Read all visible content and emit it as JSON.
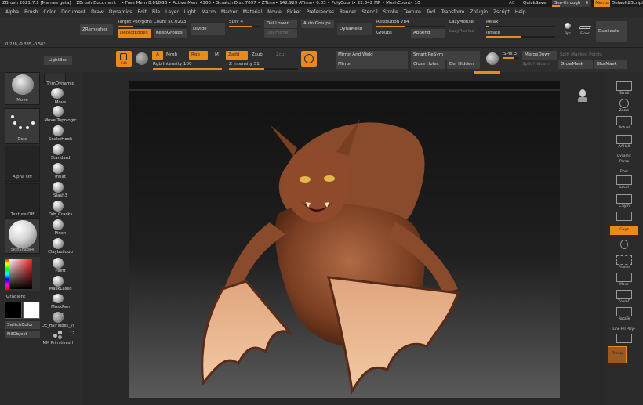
{
  "title_bar": {
    "app": "ZBrush 2021.7.1 [Marnes geta]",
    "document": "ZBrush Document",
    "stats": "• Free Mem 8.618GB • Active Mem 4360 • Scratch Disk 7097 • ZTime• 142.929 ATime• 0.03 • PolyCount• 22.342 MP • MeshCount• 10",
    "ac": "AC",
    "quicksave": "QuickSave",
    "see_through": "See-through",
    "see_through_value": "0",
    "menus_btn": "Menus",
    "default_zscript": "DefaultZScript"
  },
  "menu_bar": [
    "Alpha",
    "Brush",
    "Color",
    "Document",
    "Draw",
    "Dynamics",
    "Edit",
    "File",
    "Layer",
    "Light",
    "Macro",
    "Marker",
    "Material",
    "Movie",
    "Picker",
    "Preferences",
    "Render",
    "Stencil",
    "Stroke",
    "Texture",
    "Tool",
    "Transform",
    "Zplugin",
    "Zscript",
    "Help"
  ],
  "top_controls": {
    "zremesher": "ZRemesher",
    "target_poly": "Target Polygons Count 50.0203",
    "detect_edges": "DetectEdges",
    "keep_groups": "KeepGroups",
    "divide": "Divide",
    "sdiv": "SDiv 4",
    "del_lower": "Del Lower",
    "del_higher": "Del Higher",
    "auto_groups": "Auto Groups",
    "dynamesh": "DynaMesh",
    "resolution": "Resolution 784",
    "groups": "Groups",
    "append": "Append",
    "lazymouse": "LazyMouse",
    "lazyradius": "LazyRadius",
    "relax": "Relax",
    "inflate": "Inflate",
    "bpr": "Bpr",
    "floor": "Floor",
    "duplicate": "Duplicate"
  },
  "coords": "0.228,-0.385,-0.563",
  "tool_row": {
    "lightbox": "LightBox",
    "edit": "Edit",
    "a_label": "A",
    "mrgb": "Mrgb",
    "rgb": "Rgb",
    "m": "M",
    "zadd": "Zadd",
    "zsub": "Zsub",
    "zcut": "Zcut",
    "rgb_intensity": "Rgb Intensity 100",
    "z_intensity": "Z Intensity 51",
    "mirror_weld": "Mirror And Weld",
    "mirror": "Mirror",
    "smart_resym": "Smart ReSym",
    "close_holes": "Close Holes",
    "del_hidden": "Del Hidden",
    "spix": "SPix 3",
    "merge_down": "MergeDown",
    "split_hidden": "Split Hidden",
    "split_masked": "Split Masked Points",
    "grow_mask": "GrowMask",
    "blur_mask": "BlurMask"
  },
  "left_shelf": {
    "move": "Move",
    "dots": "Dots",
    "alpha_off": "Alpha Off",
    "texture_off": "Texture Off",
    "material": "SkinShade4",
    "gradient": "Gradient",
    "switch_color": "SwitchColor",
    "fill_object": "FillObject",
    "brushes": [
      "TrimDynamic",
      "Move",
      "Move Topologic",
      "SnakeHook",
      "Standard",
      "Inflat",
      "Slash3",
      "Orb_Cracks",
      "Pinch",
      "Claybuildup",
      "Paint",
      "MaskLasso",
      "MaskPen"
    ],
    "hairtubes": "DE_HairTubes_vi",
    "hairtubes_count": "6",
    "imm_primitives": "IMM PrimitivesH",
    "imm_count": "12"
  },
  "right_shelf": [
    "Scroll",
    "Zoom",
    "Actual",
    "AAHalf",
    "Persp",
    "Floor",
    "Local",
    "L.Sym",
    "Gxyz",
    "Frame",
    "Move",
    "ZoomD",
    "RotaTe",
    "Line Fill PolyF",
    "Transp"
  ],
  "right_shelf_sub": "Dynamic",
  "right_shelf_sub2": "Local",
  "colors": {
    "accent": "#e98a1a",
    "panel": "#2e2e2e",
    "button": "#404040",
    "viewport_top": "#121212",
    "viewport_bottom": "#5a5a5a"
  }
}
